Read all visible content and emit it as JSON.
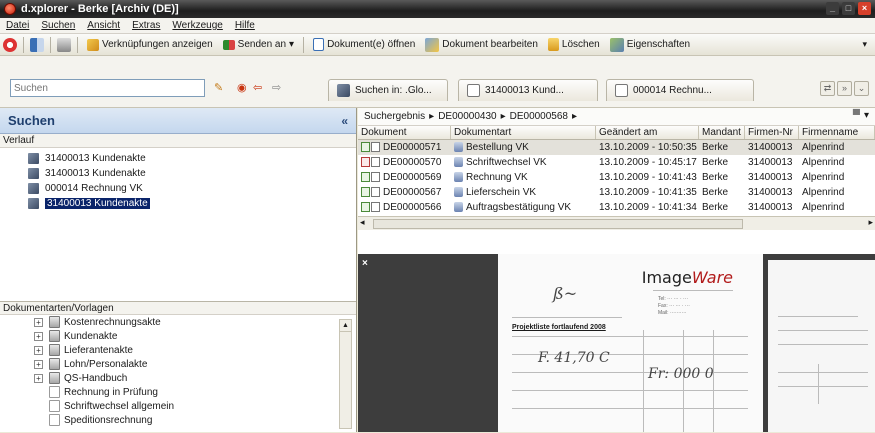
{
  "window": {
    "title": "d.xplorer - Berke [Archiv (DE)]"
  },
  "menu": [
    "Datei",
    "Suchen",
    "Ansicht",
    "Extras",
    "Werkzeuge",
    "Hilfe"
  ],
  "toolbar": {
    "verknuepfungen": "Verknüpfungen anzeigen",
    "senden": "Senden an",
    "oeffnen": "Dokument(e) öffnen",
    "bearbeiten": "Dokument bearbeiten",
    "loeschen": "Löschen",
    "eigenschaften": "Eigenschaften"
  },
  "search": {
    "placeholder": "Suchen"
  },
  "tabs": [
    "Suchen in: .Glo...",
    "31400013 Kund...",
    "000014 Rechnu..."
  ],
  "left": {
    "header": "Suchen",
    "collapse": "«",
    "history_title": "Verlauf",
    "history": [
      "31400013 Kundenakte",
      "31400013 Kundenakte",
      "000014 Rechnung VK",
      "31400013 Kundenakte"
    ],
    "doctypes_title": "Dokumentarten/Vorlagen",
    "doctypes": [
      {
        "label": "Kostenrechnungsakte",
        "expandable": true
      },
      {
        "label": "Kundenakte",
        "expandable": true
      },
      {
        "label": "Lieferantenakte",
        "expandable": true
      },
      {
        "label": "Lohn/Personalakte",
        "expandable": true
      },
      {
        "label": "QS-Handbuch",
        "expandable": true
      }
    ],
    "templates": [
      "Rechnung in Prüfung",
      "Schriftwechsel allgemein",
      "Speditionsrechnung"
    ]
  },
  "breadcrumb": [
    "Suchergebnis",
    "DE00000430",
    "DE00000568"
  ],
  "grid": {
    "headers": [
      "Dokument",
      "Dokumentart",
      "Geändert am",
      "Mandant",
      "Firmen-Nr",
      "Firmenname"
    ],
    "rows": [
      [
        "DE00000571",
        "Bestellung VK",
        "13.10.2009 - 10:50:35",
        "Berke",
        "31400013",
        "Alpenrind"
      ],
      [
        "DE00000570",
        "Schriftwechsel VK",
        "13.10.2009 - 10:45:17",
        "Berke",
        "31400013",
        "Alpenrind"
      ],
      [
        "DE00000569",
        "Rechnung VK",
        "13.10.2009 - 10:41:43",
        "Berke",
        "31400013",
        "Alpenrind"
      ],
      [
        "DE00000567",
        "Lieferschein VK",
        "13.10.2009 - 10:41:35",
        "Berke",
        "31400013",
        "Alpenrind"
      ],
      [
        "DE00000566",
        "Auftragsbestätigung VK",
        "13.10.2009 - 10:41:34",
        "Berke",
        "31400013",
        "Alpenrind"
      ]
    ]
  },
  "preview": {
    "close": "×",
    "logo_a": "Image",
    "logo_b": "Ware",
    "doc_title": "Projektliste fortlaufend 2008",
    "hand_1": "F. 41,70 C",
    "hand_2": "Fr: 000 0"
  }
}
